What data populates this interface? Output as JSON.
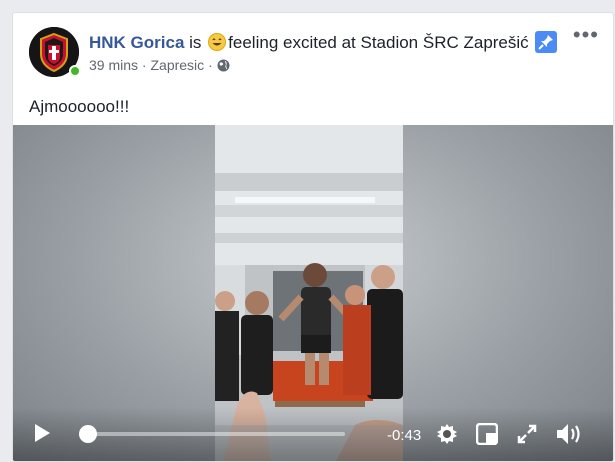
{
  "post": {
    "page_name": "HNK Gorica",
    "is_text": "is",
    "feeling_text": "feeling excited at Stadion ŠRC Zaprešić",
    "time": "39 mins",
    "separator": "·",
    "location": "Zapresic",
    "privacy_icon": "globe-icon",
    "body_text": "Ajmoooooo!!!"
  },
  "video": {
    "time_remaining": "-0:43",
    "progress": 0.0,
    "icons": [
      "play-icon",
      "settings-icon",
      "pip-icon",
      "fullscreen-icon",
      "volume-icon"
    ]
  },
  "colors": {
    "link": "#365899",
    "online": "#42b72a",
    "pin": "#4c8bf5"
  }
}
